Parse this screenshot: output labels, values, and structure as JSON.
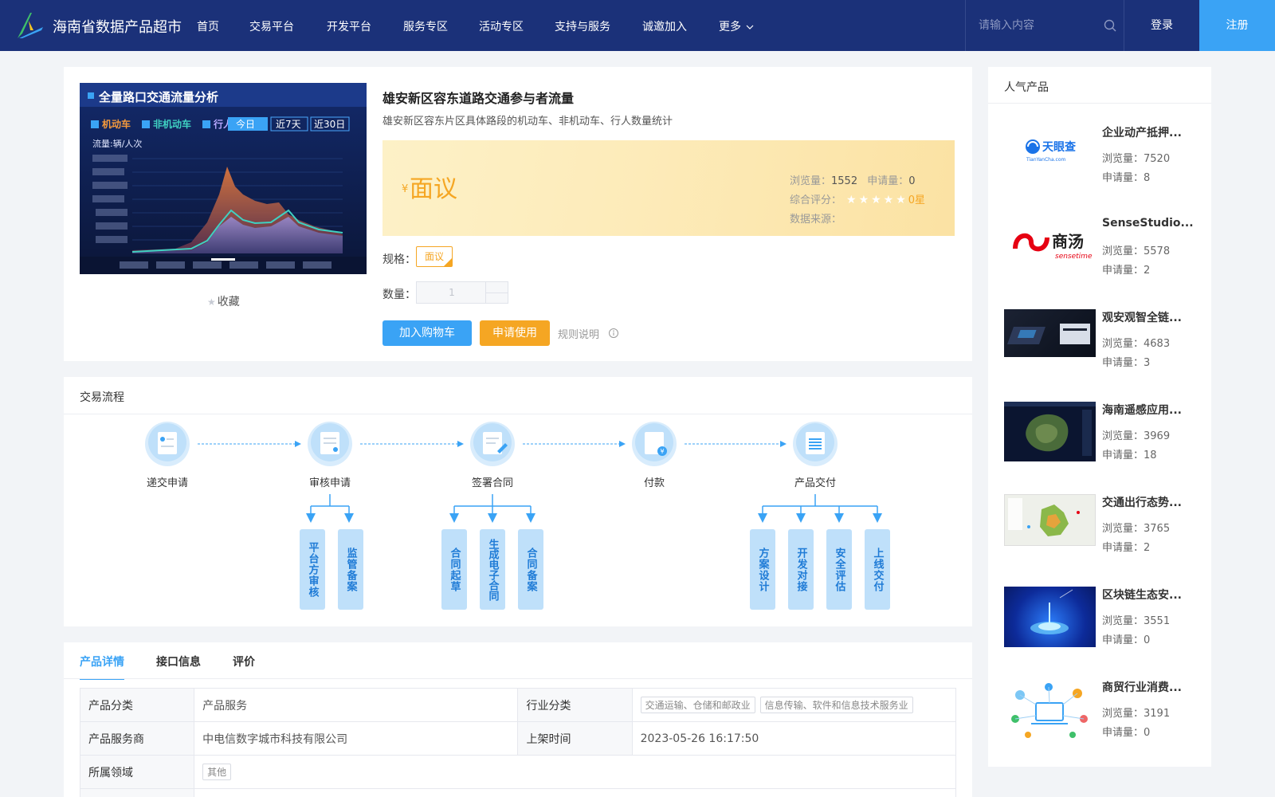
{
  "header": {
    "brand": "海南省数据产品超市",
    "nav": [
      "首页",
      "交易平台",
      "开发平台",
      "服务专区",
      "活动专区",
      "支持与服务",
      "诚邀加入",
      "更多"
    ],
    "search_placeholder": "请输入内容",
    "login": "登录",
    "register": "注册"
  },
  "product": {
    "image_title": "全量路口交通流量分析",
    "image_legend": [
      "机动车",
      "非机动车",
      "行人"
    ],
    "image_buttons": [
      "今日",
      "近7天",
      "近30日"
    ],
    "image_unit": "流量:辆/人次",
    "favorite": "收藏",
    "title": "雄安新区容东道路交通参与者流量",
    "subtitle": "雄安新区容东片区具体路段的机动车、非机动车、行人数量统计",
    "price_symbol": "¥",
    "price": "面议",
    "views_label": "浏览量：",
    "views": "1552",
    "applications_label": "申请量：",
    "applications": "0",
    "rating_label": "综合评分：",
    "rating": "0星",
    "source_label": "数据来源：",
    "spec_label": "规格：",
    "spec_value": "面议",
    "qty_label": "数量：",
    "qty_value": "1",
    "add_cart": "加入购物车",
    "apply": "申请使用",
    "rules": "规则说明"
  },
  "flow": {
    "title": "交易流程",
    "steps": [
      "递交申请",
      "审核申请",
      "签署合同",
      "付款",
      "产品交付"
    ],
    "review_substeps": [
      "平台方审核",
      "监管备案"
    ],
    "contract_substeps": [
      "合同起草",
      "生成电子合同",
      "合同备案"
    ],
    "delivery_substeps": [
      "方案设计",
      "开发对接",
      "安全评估",
      "上线交付"
    ]
  },
  "details": {
    "tabs": [
      "产品详情",
      "接口信息",
      "评价"
    ],
    "category_label": "产品分类",
    "category": "产品服务",
    "industry_label": "行业分类",
    "industry_tags": [
      "交通运输、仓储和邮政业",
      "信息传输、软件和信息技术服务业"
    ],
    "provider_label": "产品服务商",
    "provider": "中电信数字城市科技有限公司",
    "listed_label": "上架时间",
    "listed": "2023-05-26 16:17:50",
    "domain_label": "所属领域",
    "domain_tag": "其他"
  },
  "sidebar": {
    "title": "人气产品",
    "thumb_logos": [
      "天眼查",
      "TianYanCha.com",
      "商汤",
      "sensetime"
    ],
    "items": [
      {
        "name": "企业动产抵押...",
        "views": "浏览量：7520",
        "apps": "申请量：8"
      },
      {
        "name": "SenseStudio...",
        "views": "浏览量：5578",
        "apps": "申请量：2"
      },
      {
        "name": "观安观智全链...",
        "views": "浏览量：4683",
        "apps": "申请量：3"
      },
      {
        "name": "海南遥感应用...",
        "views": "浏览量：3969",
        "apps": "申请量：18"
      },
      {
        "name": "交通出行态势...",
        "views": "浏览量：3765",
        "apps": "申请量：2"
      },
      {
        "name": "区块链生态安...",
        "views": "浏览量：3551",
        "apps": "申请量：0"
      },
      {
        "name": "商贸行业消费...",
        "views": "浏览量：3191",
        "apps": "申请量：0"
      }
    ]
  }
}
